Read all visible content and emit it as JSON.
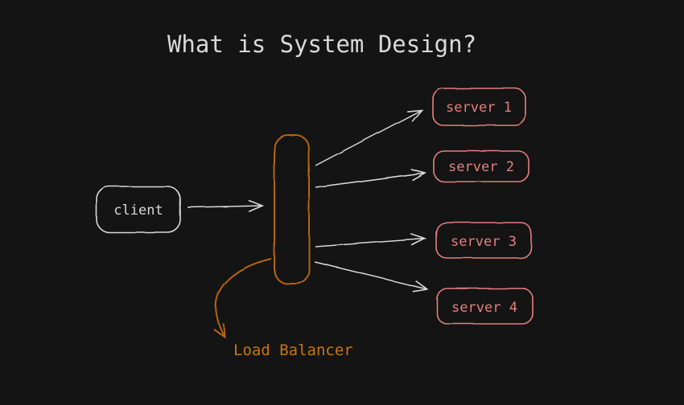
{
  "title": "What is System Design?",
  "client": {
    "label": "client"
  },
  "load_balancer": {
    "label": "Load Balancer"
  },
  "servers": [
    {
      "label": "server 1"
    },
    {
      "label": "server 2"
    },
    {
      "label": "server 3"
    },
    {
      "label": "server 4"
    }
  ],
  "colors": {
    "background": "#141414",
    "foreground": "#d9d9d9",
    "server": "#e77e7e",
    "orange-stroke": "#b4650e",
    "orange-text": "#c9750f"
  }
}
